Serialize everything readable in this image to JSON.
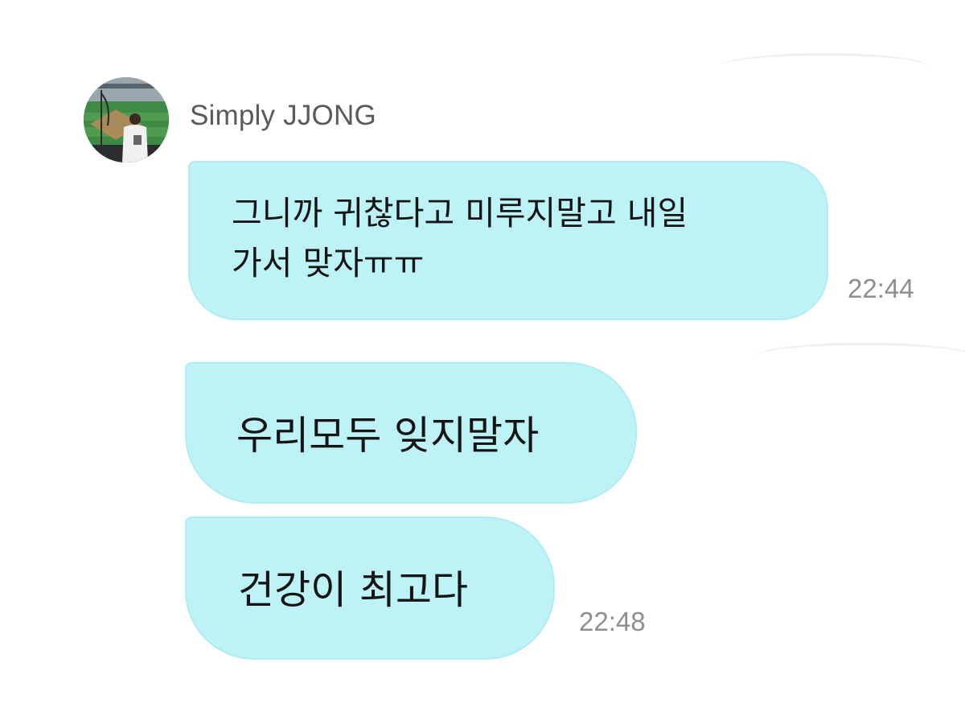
{
  "chat": {
    "sender": {
      "name": "Simply JJONG",
      "avatar": "avatar"
    },
    "messages": [
      {
        "lines": [
          "그니까 귀찮다고 미루지말고 내일",
          "가서 맞자ㅠㅠ"
        ],
        "time": "22:44"
      },
      {
        "lines": [
          "우리모두 잊지말자"
        ],
        "time": ""
      },
      {
        "lines": [
          "건강이 최고다"
        ],
        "time": "22:48"
      }
    ],
    "colors": {
      "bubble": "#bdf3f6",
      "bubble_border": "#b0ecef",
      "name": "#5a5a5a",
      "timestamp": "#8e8e8e",
      "text": "#151515"
    }
  }
}
